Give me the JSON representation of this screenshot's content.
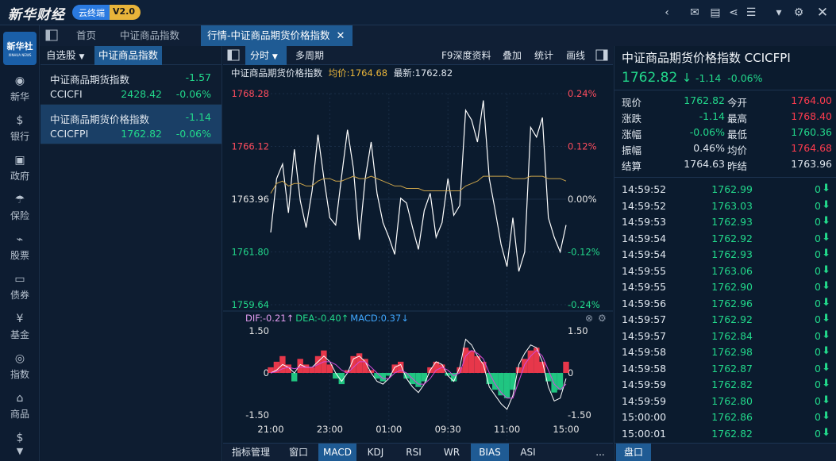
{
  "app": {
    "logo": "新华财经",
    "cloud": "云终端",
    "version": "V2.0"
  },
  "window_controls": [
    "back",
    "mail",
    "chat",
    "share",
    "list",
    "shirt",
    "gear",
    "close"
  ],
  "tabs": [
    {
      "label": "首页"
    },
    {
      "label": "中证商品指数"
    },
    {
      "label": "行情-中证商品期货价格指数"
    }
  ],
  "sidebar": [
    {
      "icon": "xinhua-icon",
      "label": "新华"
    },
    {
      "icon": "dollar-icon",
      "label": "银行"
    },
    {
      "icon": "government-icon",
      "label": "政府"
    },
    {
      "icon": "umbrella-icon",
      "label": "保险"
    },
    {
      "icon": "stock-chart-icon",
      "label": "股票"
    },
    {
      "icon": "bond-icon",
      "label": "债券"
    },
    {
      "icon": "fund-icon",
      "label": "基金"
    },
    {
      "icon": "index-icon",
      "label": "指数"
    },
    {
      "icon": "commodity-icon",
      "label": "商品"
    },
    {
      "icon": "fx-icon",
      "label": ""
    }
  ],
  "sidebar_logo": {
    "title": "新华社",
    "sub": "XINHUA NEWS"
  },
  "watchlist": {
    "tab1": "自选股",
    "tab2": "中证商品指数",
    "rows": [
      {
        "name": "中证商品期货指数",
        "change": "-1.57",
        "code": "CCICFI",
        "price": "2428.42",
        "pct": "-0.06%"
      },
      {
        "name": "中证商品期货价格指数",
        "change": "-1.14",
        "code": "CCICFPI",
        "price": "1762.82",
        "pct": "-0.06%"
      }
    ]
  },
  "chart_toolbar": {
    "period": "分时",
    "multi": "多周期",
    "f9": "F9深度资料",
    "overlay": "叠加",
    "stats": "统计",
    "draw": "画线"
  },
  "chart_header": {
    "name": "中证商品期货价格指数",
    "avg": "均价:1764.68",
    "last": "最新:1762.82"
  },
  "indicator": {
    "dif": "DIF:-0.21↑",
    "dea": "DEA:-0.40↑",
    "macd": "MACD:0.37↓"
  },
  "bottom_tabs": [
    "指标管理",
    "窗口",
    "MACD",
    "KDJ",
    "RSI",
    "WR",
    "BIAS",
    "ASI",
    "..."
  ],
  "quote": {
    "name": "中证商品期货价格指数",
    "code": "CCICFPI",
    "price": "1762.82",
    "arrow": "↓",
    "change": "-1.14",
    "pct": "-0.06%",
    "stats": [
      {
        "l": "现价",
        "v": "1762.82",
        "l2": "今开",
        "v2": "1764.00"
      },
      {
        "l": "涨跌",
        "v": "-1.14",
        "l2": "最高",
        "v2": "1768.40"
      },
      {
        "l": "涨幅",
        "v": "-0.06%",
        "l2": "最低",
        "v2": "1760.36"
      },
      {
        "l": "振幅",
        "v": "0.46%",
        "l2": "均价",
        "v2": "1764.68"
      },
      {
        "l": "结算",
        "v": "1764.63",
        "l2": "昨结",
        "v2": "1763.96"
      }
    ],
    "ticks": [
      {
        "t": "14:59:52",
        "p": "1762.99",
        "v": "0"
      },
      {
        "t": "14:59:52",
        "p": "1763.03",
        "v": "0"
      },
      {
        "t": "14:59:53",
        "p": "1762.93",
        "v": "0"
      },
      {
        "t": "14:59:54",
        "p": "1762.92",
        "v": "0"
      },
      {
        "t": "14:59:54",
        "p": "1762.93",
        "v": "0"
      },
      {
        "t": "14:59:55",
        "p": "1763.06",
        "v": "0"
      },
      {
        "t": "14:59:55",
        "p": "1762.90",
        "v": "0"
      },
      {
        "t": "14:59:56",
        "p": "1762.96",
        "v": "0"
      },
      {
        "t": "14:59:57",
        "p": "1762.92",
        "v": "0"
      },
      {
        "t": "14:59:57",
        "p": "1762.84",
        "v": "0"
      },
      {
        "t": "14:59:58",
        "p": "1762.98",
        "v": "0"
      },
      {
        "t": "14:59:58",
        "p": "1762.87",
        "v": "0"
      },
      {
        "t": "14:59:59",
        "p": "1762.82",
        "v": "0"
      },
      {
        "t": "14:59:59",
        "p": "1762.80",
        "v": "0"
      },
      {
        "t": "15:00:00",
        "p": "1762.86",
        "v": "0"
      },
      {
        "t": "15:00:01",
        "p": "1762.82",
        "v": "0"
      }
    ],
    "pankou": "盘口"
  },
  "colors": {
    "up": "#ff3b4e",
    "down": "#22d88b",
    "price_line": "#ffffff",
    "avg_line": "#c9a24a",
    "dif": "#ffffff",
    "dea": "#d24bd8"
  },
  "chart_data": {
    "type": "line",
    "title": "中证商品期货价格指数",
    "x_ticks": [
      "21:00",
      "23:00",
      "01:00",
      "09:30",
      "11:00",
      "15:00"
    ],
    "y_ticks_left": [
      "1768.28",
      "1766.12",
      "1763.96",
      "1761.80",
      "1759.64"
    ],
    "y_ticks_right": [
      "0.24%",
      "0.12%",
      "0.00%",
      "-0.12%",
      "-0.24%"
    ],
    "ylim": [
      1759.64,
      1768.28
    ],
    "series": [
      {
        "values": [
          1762.6,
          1764.8,
          1765.4,
          1763.4,
          1766.0,
          1763.9,
          1762.8,
          1764.3,
          1766.6,
          1764.8,
          1763.2,
          1762.9,
          1764.9,
          1766.8,
          1765.2,
          1762.3,
          1764.8,
          1766.3,
          1764.2,
          1763.0,
          1762.4,
          1761.7,
          1764.0,
          1763.8,
          1762.8,
          1761.9,
          1763.5,
          1764.2,
          1762.4,
          1763.0,
          1764.8,
          1763.3,
          1763.7,
          1767.6,
          1767.2,
          1766.3,
          1768.0,
          1764.8,
          1763.5,
          1762.1,
          1761.2,
          1763.2,
          1761.0,
          1761.8,
          1766.9,
          1766.5,
          1767.3,
          1763.2,
          1762.4,
          1761.8,
          1762.9
        ]
      },
      {
        "values": [
          1764.2,
          1764.6,
          1764.7,
          1764.5,
          1764.6,
          1764.6,
          1764.5,
          1764.5,
          1764.7,
          1764.8,
          1764.8,
          1764.7,
          1764.7,
          1764.8,
          1764.9,
          1764.8,
          1764.8,
          1764.9,
          1764.8,
          1764.7,
          1764.6,
          1764.5,
          1764.5,
          1764.4,
          1764.4,
          1764.4,
          1764.3,
          1764.3,
          1764.3,
          1764.3,
          1764.3,
          1764.3,
          1764.3,
          1764.5,
          1764.6,
          1764.7,
          1764.9,
          1764.9,
          1764.9,
          1764.9,
          1764.9,
          1764.8,
          1764.8,
          1764.8,
          1764.9,
          1764.9,
          1764.9,
          1764.8,
          1764.8,
          1764.8,
          1764.7
        ]
      }
    ],
    "macd": {
      "ylim": [
        -1.5,
        1.5
      ],
      "y_ticks": [
        "1.50",
        "0",
        "-1.50"
      ],
      "hist": [
        0.2,
        0.4,
        0.6,
        0.3,
        -0.3,
        0.5,
        0.3,
        0.2,
        0.6,
        0.8,
        0.3,
        -0.2,
        -0.4,
        0.1,
        0.6,
        0.7,
        0.5,
        0.1,
        -0.2,
        -0.3,
        -0.1,
        0.3,
        0.4,
        -0.2,
        -0.4,
        -0.5,
        -0.3,
        0.2,
        0.4,
        0.3,
        -0.1,
        -0.3,
        0.2,
        0.9,
        0.8,
        0.6,
        0.4,
        -0.4,
        -0.6,
        -0.8,
        -0.9,
        -0.6,
        0.2,
        0.5,
        0.8,
        0.9,
        0.4,
        -0.3,
        -0.7,
        -0.6,
        0.4
      ],
      "dif": [
        0.0,
        0.1,
        0.3,
        0.2,
        0.0,
        0.3,
        0.2,
        0.2,
        0.4,
        0.6,
        0.4,
        0.0,
        -0.3,
        0.0,
        0.5,
        0.6,
        0.4,
        0.0,
        -0.3,
        -0.4,
        -0.2,
        0.2,
        0.3,
        -0.2,
        -0.5,
        -0.7,
        -0.4,
        0.1,
        0.4,
        0.3,
        -0.1,
        -0.3,
        0.2,
        1.2,
        1.0,
        0.6,
        0.3,
        -0.5,
        -0.8,
        -1.1,
        -1.3,
        -0.8,
        0.3,
        0.7,
        1.0,
        0.9,
        0.4,
        -0.5,
        -1.0,
        -0.9,
        -0.2
      ],
      "dea": [
        0.0,
        0.05,
        0.15,
        0.2,
        0.15,
        0.2,
        0.2,
        0.2,
        0.3,
        0.4,
        0.4,
        0.3,
        0.1,
        0.0,
        0.2,
        0.4,
        0.4,
        0.2,
        0.0,
        -0.2,
        -0.2,
        0.0,
        0.1,
        0.0,
        -0.2,
        -0.4,
        -0.4,
        -0.2,
        0.1,
        0.2,
        0.1,
        -0.1,
        0.0,
        0.6,
        0.8,
        0.7,
        0.5,
        0.0,
        -0.4,
        -0.7,
        -0.9,
        -0.9,
        -0.3,
        0.3,
        0.6,
        0.8,
        0.6,
        0.1,
        -0.4,
        -0.6,
        -0.4
      ]
    }
  }
}
